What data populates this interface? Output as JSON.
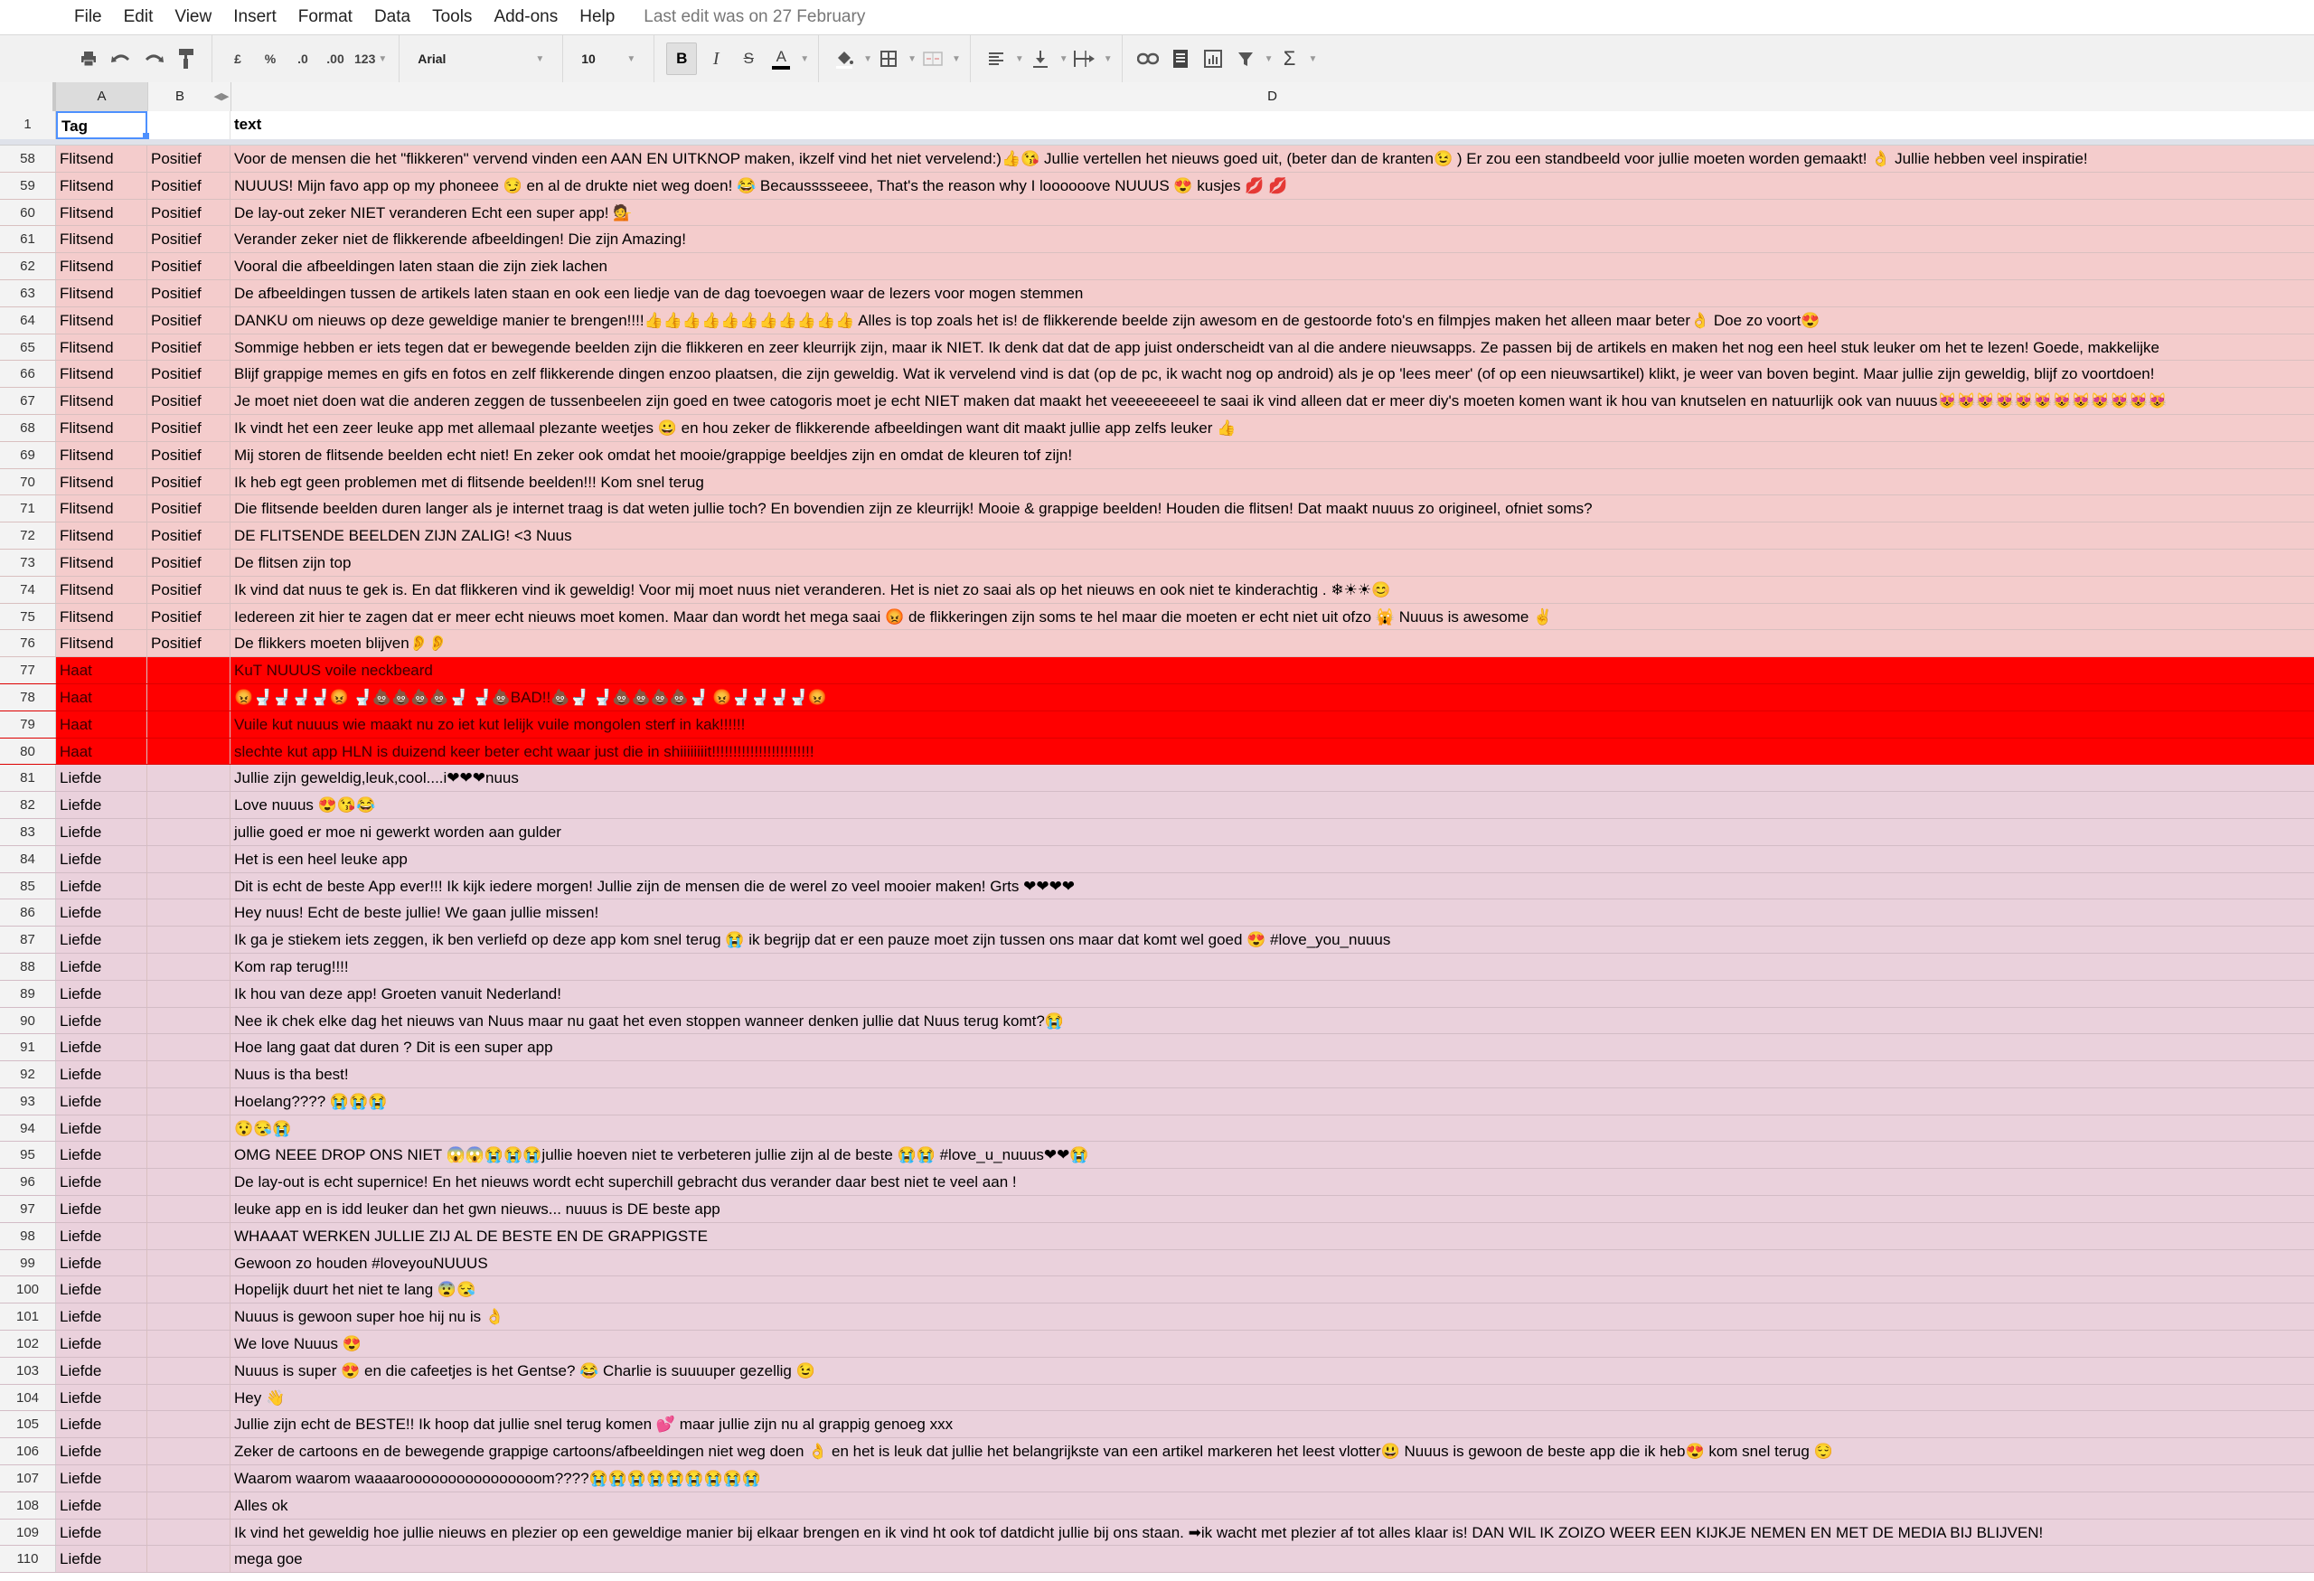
{
  "menu": {
    "items": [
      "File",
      "Edit",
      "View",
      "Insert",
      "Format",
      "Data",
      "Tools",
      "Add-ons",
      "Help"
    ],
    "last_edit": "Last edit was on 27 February"
  },
  "toolbar": {
    "print": "print-icon",
    "undo": "undo-icon",
    "redo": "redo-icon",
    "paint_format": "paint-format-icon",
    "currency": "£",
    "percent": "%",
    "decrease_decimal": ".0",
    "increase_decimal": ".00",
    "more_formats": "123",
    "font": "Arial",
    "font_size": "10",
    "bold": "B",
    "italic": "I",
    "strikethrough": "S",
    "text_color": "A",
    "sum": "Σ"
  },
  "columns": {
    "a": "A",
    "b": "B",
    "d": "D"
  },
  "header_row": {
    "num": "1",
    "tag": "Tag",
    "b": "",
    "text": "text"
  },
  "colors": {
    "flitsend": "#f4cccc",
    "haat": "#ff0000",
    "liefde": "#ead1dc",
    "selection": "#4d90fe"
  },
  "rows": [
    {
      "num": "58",
      "tag": "Flitsend",
      "sentiment": "Positief",
      "text": "Voor de mensen die het \"flikkeren\" vervend vinden een AAN EN UITKNOP maken, ikzelf vind het niet vervelend:)👍😘 Jullie vertellen het nieuws goed uit, (beter dan de kranten😉 ) Er zou een standbeeld voor jullie moeten worden gemaakt! 👌 Jullie hebben veel inspiratie!"
    },
    {
      "num": "59",
      "tag": "Flitsend",
      "sentiment": "Positief",
      "text": "NUUUS! Mijn favo app op my phoneee 😏  en al de drukte niet weg doen! 😂  Becausssseeee, That's the reason why I loooooove NUUUS 😍  kusjes 💋 💋"
    },
    {
      "num": "60",
      "tag": "Flitsend",
      "sentiment": "Positief",
      "text": "De lay-out zeker NIET veranderen Echt een super app! 💁"
    },
    {
      "num": "61",
      "tag": "Flitsend",
      "sentiment": "Positief",
      "text": "Verander zeker niet de flikkerende afbeeldingen! Die zijn Amazing!"
    },
    {
      "num": "62",
      "tag": "Flitsend",
      "sentiment": "Positief",
      "text": "Vooral die afbeeldingen laten staan die zijn ziek lachen"
    },
    {
      "num": "63",
      "tag": "Flitsend",
      "sentiment": "Positief",
      "text": "De afbeeldingen tussen de artikels laten staan en ook een liedje van de dag toevoegen waar de lezers voor mogen stemmen"
    },
    {
      "num": "64",
      "tag": "Flitsend",
      "sentiment": "Positief",
      "text": "DANKU om nieuws op deze geweldige manier te brengen!!!!👍👍👍👍👍👍👍👍👍👍👍  Alles is top zoals het is! de flikkerende beelde zijn awesom en de gestoorde foto's en filmpjes maken het alleen maar beter👌  Doe zo voort😍"
    },
    {
      "num": "65",
      "tag": "Flitsend",
      "sentiment": "Positief",
      "text": "Sommige hebben er iets tegen dat er bewegende beelden zijn die flikkeren en zeer kleurrijk zijn, maar ik NIET. Ik denk dat dat de app juist onderscheidt van al die andere nieuwsapps. Ze passen bij de artikels en maken het nog een heel stuk leuker om het te lezen! Goede, makkelijke"
    },
    {
      "num": "66",
      "tag": "Flitsend",
      "sentiment": "Positief",
      "text": "Blijf grappige memes en gifs en fotos en zelf flikkerende dingen enzoo plaatsen, die zijn geweldig. Wat ik vervelend vind is dat (op de pc, ik wacht nog op android) als je op 'lees meer' (of op een nieuwsartikel) klikt, je weer van boven begint. Maar jullie zijn geweldig, blijf zo voortdoen!"
    },
    {
      "num": "67",
      "tag": "Flitsend",
      "sentiment": "Positief",
      "text": "Je moet niet doen wat die anderen zeggen de tussenbeelen zijn goed en twee catogoris moet je echt NIET maken dat maakt het veeeeeeeeel te saai ik vind alleen dat er meer  diy's moeten komen want ik hou van knutselen en natuurlijk ook van nuuus😻😻😻😻😻😻😻😻😻😻😻😻"
    },
    {
      "num": "68",
      "tag": "Flitsend",
      "sentiment": "Positief",
      "text": "Ik vindt het een zeer leuke app met allemaal plezante weetjes 😀 en hou zeker de flikkerende afbeeldingen want dit maakt jullie app zelfs leuker 👍"
    },
    {
      "num": "69",
      "tag": "Flitsend",
      "sentiment": "Positief",
      "text": "Mij storen de flitsende beelden echt niet! En zeker ook omdat het mooie/grappige beeldjes zijn en omdat de kleuren tof zijn!"
    },
    {
      "num": "70",
      "tag": "Flitsend",
      "sentiment": "Positief",
      "text": "Ik heb egt geen problemen met di flitsende beelden!!! Kom snel terug"
    },
    {
      "num": "71",
      "tag": "Flitsend",
      "sentiment": "Positief",
      "text": "Die flitsende beelden duren langer als je internet traag is dat weten jullie toch? En bovendien zijn ze kleurrijk! Mooie & grappige beelden! Houden die flitsen! Dat maakt nuuus zo origineel, ofniet soms?"
    },
    {
      "num": "72",
      "tag": "Flitsend",
      "sentiment": "Positief",
      "text": "DE FLITSENDE BEELDEN ZIJN ZALIG! <3 Nuus"
    },
    {
      "num": "73",
      "tag": "Flitsend",
      "sentiment": "Positief",
      "text": "De flitsen zijn top"
    },
    {
      "num": "74",
      "tag": "Flitsend",
      "sentiment": "Positief",
      "text": "Ik vind dat nuus te gek is. En dat flikkeren vind ik geweldig! Voor mij moet nuus niet veranderen. Het is niet zo saai als op het nieuws en ook niet te kinderachtig . ❄☀☀😊"
    },
    {
      "num": "75",
      "tag": "Flitsend",
      "sentiment": "Positief",
      "text": "Iedereen zit hier te zagen dat er meer echt nieuws moet komen. Maar dan wordt het mega saai 😡 de flikkeringen zijn soms te hel maar die moeten er echt niet uit ofzo 🙀 Nuuus is awesome ✌"
    },
    {
      "num": "76",
      "tag": "Flitsend",
      "sentiment": "Positief",
      "text": "De flikkers moeten blijven👂👂"
    },
    {
      "num": "77",
      "tag": "Haat",
      "sentiment": "",
      "text": "KuT NUUUS  voile neckbeard"
    },
    {
      "num": "78",
      "tag": "Haat",
      "sentiment": "",
      "text": "😡🚽🚽🚽🚽😡  🚽💩💩💩💩🚽  🚽💩BAD!!💩🚽  🚽💩💩💩💩🚽  😡🚽🚽🚽🚽😡"
    },
    {
      "num": "79",
      "tag": "Haat",
      "sentiment": "",
      "text": "Vuile kut nuuus wie maakt nu zo iet kut lelijk vuile mongolen sterf in kak!!!!!!"
    },
    {
      "num": "80",
      "tag": "Haat",
      "sentiment": "",
      "text": "slechte kut app HLN is duizend keer beter echt waar just die in shiiiiiiiit!!!!!!!!!!!!!!!!!!!!!!!!"
    },
    {
      "num": "81",
      "tag": "Liefde",
      "sentiment": "",
      "text": "Jullie zijn geweldig,leuk,cool....i❤❤❤nuus"
    },
    {
      "num": "82",
      "tag": "Liefde",
      "sentiment": "",
      "text": "Love nuuus 😍😘😂"
    },
    {
      "num": "83",
      "tag": "Liefde",
      "sentiment": "",
      "text": "jullie goed er moe ni gewerkt worden aan gulder"
    },
    {
      "num": "84",
      "tag": "Liefde",
      "sentiment": "",
      "text": "Het is een heel leuke app"
    },
    {
      "num": "85",
      "tag": "Liefde",
      "sentiment": "",
      "text": "Dit is echt de beste App ever!!! Ik kijk iedere morgen! Jullie zijn de mensen die de werel zo veel mooier maken! Grts ❤❤❤❤"
    },
    {
      "num": "86",
      "tag": "Liefde",
      "sentiment": "",
      "text": "Hey nuus! Echt de beste jullie! We gaan jullie missen!"
    },
    {
      "num": "87",
      "tag": "Liefde",
      "sentiment": "",
      "text": "Ik ga je stiekem iets zeggen, ik ben verliefd op deze app kom snel terug 😭  ik begrijp dat er een pauze moet zijn tussen ons maar dat komt wel goed 😍  #love_you_nuuus"
    },
    {
      "num": "88",
      "tag": "Liefde",
      "sentiment": "",
      "text": "Kom rap terug!!!!"
    },
    {
      "num": "89",
      "tag": "Liefde",
      "sentiment": "",
      "text": "Ik hou van deze app! Groeten vanuit Nederland!"
    },
    {
      "num": "90",
      "tag": "Liefde",
      "sentiment": "",
      "text": "Nee ik chek elke dag het nieuws van Nuus maar nu gaat het even stoppen wanneer denken jullie dat Nuus terug komt?😭"
    },
    {
      "num": "91",
      "tag": "Liefde",
      "sentiment": "",
      "text": "Hoe lang gaat dat duren ?  Dit is een super app"
    },
    {
      "num": "92",
      "tag": "Liefde",
      "sentiment": "",
      "text": "Nuus is tha best!"
    },
    {
      "num": "93",
      "tag": "Liefde",
      "sentiment": "",
      "text": "Hoelang???? 😭😭😭"
    },
    {
      "num": "94",
      "tag": "Liefde",
      "sentiment": "",
      "text": "😯😪😭"
    },
    {
      "num": "95",
      "tag": "Liefde",
      "sentiment": "",
      "text": "OMG NEEE DROP ONS NIET 😱😱😭😭😭jullie hoeven niet te verbeteren jullie zijn al de beste 😭😭  #love_u_nuuus❤❤😭"
    },
    {
      "num": "96",
      "tag": "Liefde",
      "sentiment": "",
      "text": "De lay-out is echt supernice! En het nieuws wordt echt superchill gebracht dus verander daar best niet te veel aan !"
    },
    {
      "num": "97",
      "tag": "Liefde",
      "sentiment": "",
      "text": "leuke app en is idd leuker dan het gwn nieuws... nuuus is DE beste app"
    },
    {
      "num": "98",
      "tag": "Liefde",
      "sentiment": "",
      "text": "WHAAAT WERKEN JULLIE ZIJ AL DE BESTE EN DE GRAPPIGSTE"
    },
    {
      "num": "99",
      "tag": "Liefde",
      "sentiment": "",
      "text": "Gewoon zo houden #loveyouNUUUS"
    },
    {
      "num": "100",
      "tag": "Liefde",
      "sentiment": "",
      "text": "Hopelijk duurt het niet te lang 😨😪"
    },
    {
      "num": "101",
      "tag": "Liefde",
      "sentiment": "",
      "text": "Nuuus is gewoon super hoe hij nu is 👌"
    },
    {
      "num": "102",
      "tag": "Liefde",
      "sentiment": "",
      "text": "We love Nuuus 😍"
    },
    {
      "num": "103",
      "tag": "Liefde",
      "sentiment": "",
      "text": "Nuuus is super 😍  en die cafeetjes is het Gentse? 😂  Charlie is suuuuper gezellig 😉"
    },
    {
      "num": "104",
      "tag": "Liefde",
      "sentiment": "",
      "text": "Hey 👋"
    },
    {
      "num": "105",
      "tag": "Liefde",
      "sentiment": "",
      "text": "Jullie zijn echt de BESTE!! Ik hoop dat jullie snel terug komen 💕  maar jullie zijn nu al grappig genoeg xxx"
    },
    {
      "num": "106",
      "tag": "Liefde",
      "sentiment": "",
      "text": "Zeker de cartoons en de bewegende grappige cartoons/afbeeldingen niet weg doen 👌  en het is leuk dat jullie het belangrijkste van een artikel markeren het leest vlotter😃  Nuuus is gewoon de beste app die ik heb😍  kom snel terug 😌"
    },
    {
      "num": "107",
      "tag": "Liefde",
      "sentiment": "",
      "text": "Waarom waarom waaaaroooooooooooooooom????😭😭😭😭😭😭😭😭😭"
    },
    {
      "num": "108",
      "tag": "Liefde",
      "sentiment": "",
      "text": "Alles ok"
    },
    {
      "num": "109",
      "tag": "Liefde",
      "sentiment": "",
      "text": "Ik vind het geweldig hoe jullie nieuws en plezier op een geweldige manier bij elkaar brengen en ik vind ht ook tof datdicht jullie bij ons staan. ➡ik wacht met plezier af tot alles klaar is! DAN WIL IK ZOIZO WEER EEN KIJKJE NEMEN EN MET DE MEDIA BIJ BLIJVEN!"
    },
    {
      "num": "110",
      "tag": "Liefde",
      "sentiment": "",
      "text": "mega goe"
    }
  ]
}
